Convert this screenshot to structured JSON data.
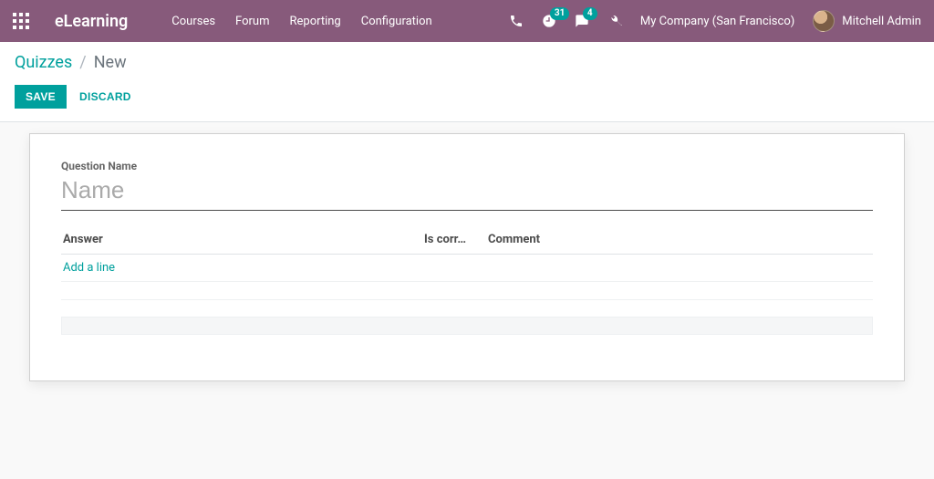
{
  "nav": {
    "brand": "eLearning",
    "menu": [
      "Courses",
      "Forum",
      "Reporting",
      "Configuration"
    ],
    "badge_activities": "31",
    "badge_messages": "4",
    "company": "My Company (San Francisco)",
    "user_name": "Mitchell Admin"
  },
  "breadcrumb": {
    "parent": "Quizzes",
    "current": "New"
  },
  "buttons": {
    "save": "SAVE",
    "discard": "DISCARD"
  },
  "form": {
    "question_label": "Question Name",
    "question_placeholder": "Name",
    "question_value": "",
    "columns": {
      "answer": "Answer",
      "is_correct": "Is corr…",
      "comment": "Comment"
    },
    "add_line": "Add a line"
  }
}
